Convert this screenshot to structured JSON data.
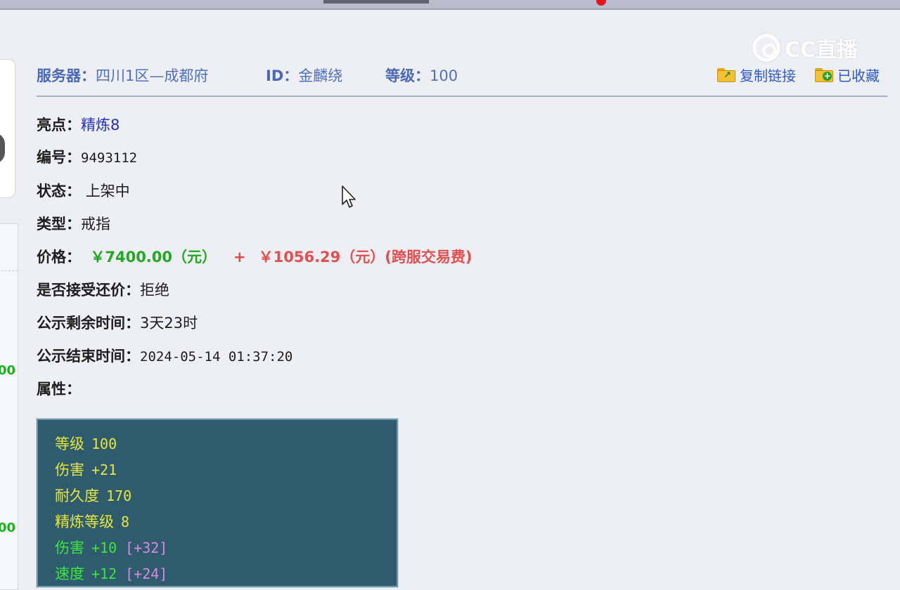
{
  "header": {
    "server_label": "服务器：",
    "server_value": "四川1区—成都府",
    "id_label": "ID：",
    "id_value": "金麟绕",
    "level_label": "等级：",
    "level_value": "100",
    "copy_link": "复制链接",
    "favorited": "已收藏"
  },
  "watermark": {
    "text": "CC直播"
  },
  "left_panel": {
    "num1": "00",
    "num2": "00"
  },
  "info": {
    "highlight_label": "亮点：",
    "highlight_value": "精炼8",
    "number_label": "编号：",
    "number_value": "9493112",
    "status_label": "状态：",
    "status_value": "上架中",
    "type_label": "类型：",
    "type_value": "戒指",
    "price_label": "价格：",
    "price_main": "￥7400.00（元）",
    "price_plus": "+",
    "price_fee": "￥1056.29（元）(跨服交易费)",
    "counter_label": "是否接受还价：",
    "counter_value": "拒绝",
    "remaining_label": "公示剩余时间：",
    "remaining_value": "3天23时",
    "end_label": "公示结束时间：",
    "end_value": "2024-05-14 01:37:20",
    "attr_label": "属性："
  },
  "attributes": [
    {
      "name": "等级",
      "value": "100",
      "bonus": "",
      "color": "#e6e63c"
    },
    {
      "name": "伤害",
      "value": "+21",
      "bonus": "",
      "color": "#e6e63c"
    },
    {
      "name": "耐久度",
      "value": "170",
      "bonus": "",
      "color": "#e6e63c"
    },
    {
      "name": "精炼等级",
      "value": "8",
      "bonus": "",
      "color": "#e6e63c"
    },
    {
      "name": "伤害",
      "value": "+10",
      "bonus": "[+32]",
      "color": "#3ce63c"
    },
    {
      "name": "速度",
      "value": "+12",
      "bonus": "[+24]",
      "color": "#3ce63c"
    }
  ]
}
